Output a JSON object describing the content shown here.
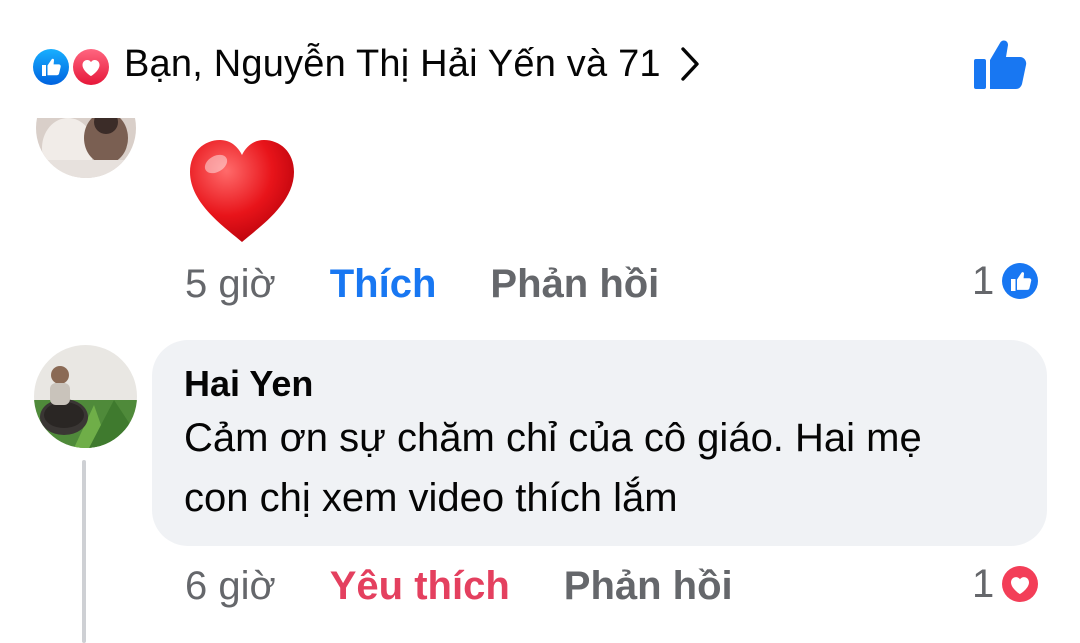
{
  "reactions_header": {
    "summary_text": "Bạn, Nguyễn Thị Hải Yến và 71",
    "icons": [
      "like-icon",
      "love-icon"
    ],
    "chevron": "chevron-right-icon",
    "like_button_icon": "thumbs-up-icon"
  },
  "comments": [
    {
      "author": "",
      "sticker": "red-heart",
      "time": "5 giờ",
      "action": "Thích",
      "action_color": "#1877f2",
      "reply": "Phản hồi",
      "reaction_count": "1",
      "reaction_icon": "like-icon"
    },
    {
      "author": "Hai Yen",
      "text_line1": "Cảm ơn sự chăm chỉ của cô giáo. Hai mẹ",
      "text_line2": "con chị xem video thích lắm",
      "time": "6 giờ",
      "action": "Yêu thích",
      "action_color": "#e4405f",
      "reply": "Phản hồi",
      "reaction_count": "1",
      "reaction_icon": "love-icon"
    }
  ],
  "colors": {
    "facebook_blue": "#1877f2",
    "love_red": "#f33e58",
    "bubble_bg": "#f0f2f5",
    "secondary_text": "#65676b"
  }
}
